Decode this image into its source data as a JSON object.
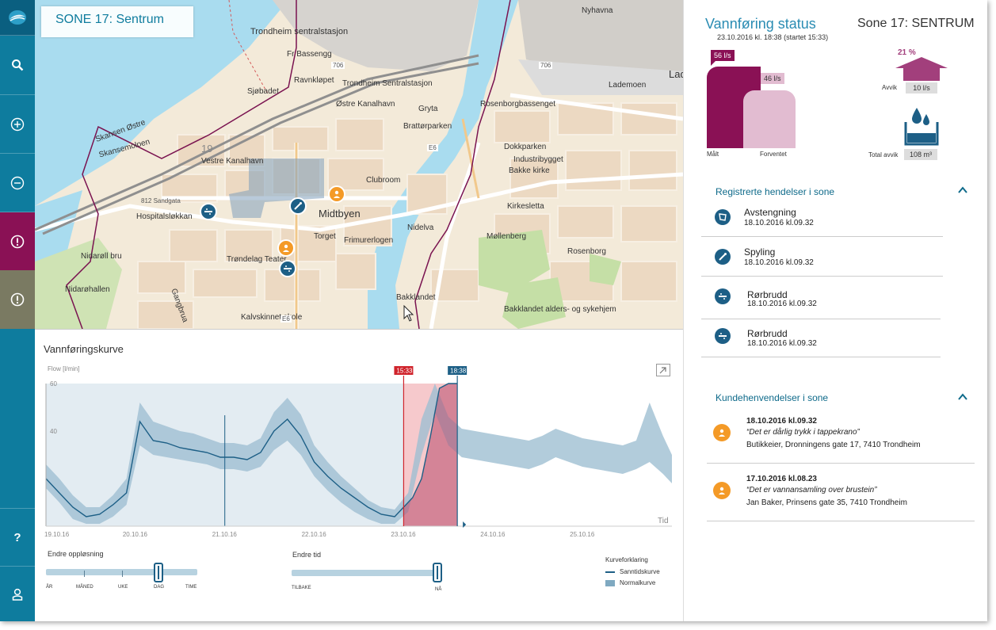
{
  "sidebar": {
    "items": [
      {
        "name": "logo",
        "icon": "logo-icon"
      },
      {
        "name": "search",
        "icon": "search-icon"
      },
      {
        "name": "zoom-in",
        "icon": "zoom-in-icon"
      },
      {
        "name": "zoom-out",
        "icon": "zoom-out-icon"
      },
      {
        "name": "alerts",
        "icon": "alert-icon"
      },
      {
        "name": "alerts-2",
        "icon": "alert-icon"
      }
    ],
    "help_label": "?",
    "user_icon": "user-icon",
    "colors": {
      "primary": "#0e7c9e",
      "alert_active": "#8a1155",
      "alert_inactive": "#7a7a62"
    }
  },
  "map": {
    "zone_title": "SONE 17: Sentrum",
    "labels": {
      "trondheim_sentralstasjon": "Trondheim sentralstasjon",
      "nyhavna": "Nyhavna",
      "fr_bassengg": "Fr Bassengg",
      "ravnkloløpet": "Ravnkløpet",
      "trondheim_sentralstasjon_2": "Trondheim Sentralstasjon",
      "sjobadet": "Sjøbadet",
      "ostre_kanalhavn": "Østre Kanalhavn",
      "gryta": "Gryta",
      "rosenborgbassenget": "Rosenborgbassenget",
      "skansen_ostre": "Skansen Østre",
      "skansemoloen": "Skansemoloen",
      "brattorparken": "Brattørparken",
      "dokkparken": "Dokkparken",
      "industribygget": "Industribygget",
      "vestre_kanalhavn": "Vestre Kanalhavn",
      "clubroom": "Clubroom",
      "bakke_kirke": "Bakke kirke",
      "midtbyen": "Midtbyen",
      "hospitalslokkan": "Hospitalsløkkan",
      "kirkesletta": "Kirkesletta",
      "torget": "Torget",
      "frimurerlogen": "Frimurerlogen",
      "nidelva": "Nidelva",
      "mollenberg": "Møllenberg",
      "nidarvoll_bru": "Nidarøll bru",
      "trondelag_teater": "Trøndelag Teater",
      "rosenborg": "Rosenborg",
      "nidarohallen": "Nidarøhallen",
      "gangbrua": "Gangbrua",
      "bakklandet": "Bakklandet",
      "bakklandet_sykehjem": "Bakklandet alders- og sykehjem",
      "kalvskinnet_skole": "Kalvskinnet skole",
      "lademoen": "Lademoen",
      "sentralsjon": "Sentralstasjon",
      "road_e6": "E6",
      "road_706": "706",
      "road_812": "812 Sandgata",
      "lad": "Lad",
      "zone_number": "19"
    }
  },
  "chart_panel": {
    "title": "Vannføringskurve",
    "expand_icon": "expand-icon",
    "time_axis_end": "Tid",
    "controls": {
      "resolution_label": "Endre oppløsning",
      "resolution_ticks": [
        "ÅR",
        "MÅNED",
        "UKE",
        "DAG",
        "TIME"
      ],
      "resolution_selected": "DAG",
      "time_label": "Endre tid",
      "time_ticks": [
        "TILBAKE",
        "NÅ"
      ],
      "time_selected": "NÅ"
    },
    "legend": {
      "title": "Kurveforklaring",
      "items": [
        {
          "label": "Sanntidskurve",
          "color": "#1d5f86"
        },
        {
          "label": "Normalkurve",
          "color": "#7fa9c1"
        }
      ]
    }
  },
  "chart_data": {
    "type": "area",
    "ylabel": "Flow [l/min]",
    "xlabel": "Tid",
    "ylim": [
      0,
      60
    ],
    "yticks": [
      40,
      60
    ],
    "x_ticks": [
      "19.10.16",
      "20.10.16",
      "21.10.16",
      "22.10.16",
      "23.10.16",
      "24.10.16",
      "25.10.16"
    ],
    "x_range_days": [
      "19.10.16",
      "26.10.16"
    ],
    "markers": [
      {
        "label": "15:33",
        "color": "#d0242c",
        "day": 4.0
      },
      {
        "label": "18:38",
        "color": "#1d5f86",
        "day": 4.6
      }
    ],
    "series": [
      {
        "name": "Sanntidskurve",
        "x_days": [
          0,
          0.15,
          0.3,
          0.45,
          0.6,
          0.75,
          0.9,
          1.05,
          1.2,
          1.35,
          1.5,
          1.65,
          1.8,
          1.95,
          2.1,
          2.25,
          2.4,
          2.55,
          2.7,
          2.85,
          3.0,
          3.15,
          3.3,
          3.45,
          3.6,
          3.75,
          3.9,
          4.0
        ],
        "values": [
          20,
          14,
          8,
          4,
          5,
          9,
          14,
          44,
          36,
          35,
          33,
          32,
          31,
          29,
          29,
          28,
          31,
          40,
          45,
          38,
          27,
          21,
          16,
          12,
          8,
          5,
          4,
          8
        ]
      },
      {
        "name": "Normalkurve",
        "x_days": [
          0,
          0.15,
          0.3,
          0.45,
          0.6,
          0.75,
          0.9,
          1.05,
          1.2,
          1.35,
          1.5,
          1.65,
          1.8,
          1.95,
          2.1,
          2.25,
          2.4,
          2.55,
          2.7,
          2.85,
          3.0,
          3.15,
          3.3,
          3.45,
          3.6,
          3.75,
          3.9,
          4.05,
          4.2,
          4.35,
          4.5,
          4.65,
          4.8,
          4.95,
          5.1,
          5.25,
          5.4,
          5.55,
          5.7,
          5.85,
          6.0,
          6.15,
          6.3,
          6.45,
          6.6,
          6.75,
          6.9,
          7.0
        ],
        "lower": [
          16,
          10,
          3,
          1,
          1,
          4,
          9,
          34,
          30,
          29,
          28,
          27,
          26,
          24,
          24,
          23,
          25,
          32,
          36,
          30,
          21,
          15,
          10,
          6,
          3,
          1,
          1,
          6,
          30,
          48,
          34,
          29,
          28,
          27,
          26,
          25,
          24,
          26,
          29,
          27,
          25,
          24,
          23,
          22,
          24,
          27,
          22,
          18
        ],
        "upper": [
          26,
          20,
          13,
          8,
          8,
          13,
          20,
          52,
          44,
          42,
          40,
          39,
          37,
          35,
          35,
          34,
          37,
          48,
          54,
          47,
          34,
          27,
          21,
          16,
          11,
          8,
          7,
          14,
          45,
          60,
          46,
          41,
          40,
          39,
          38,
          37,
          36,
          38,
          41,
          39,
          37,
          36,
          35,
          34,
          36,
          52,
          38,
          30
        ]
      },
      {
        "name": "Målt (15:33–18:38)",
        "x_days": [
          4.0,
          4.1,
          4.2,
          4.3,
          4.4,
          4.5,
          4.6
        ],
        "values": [
          8,
          12,
          20,
          38,
          58,
          60,
          60
        ]
      }
    ]
  },
  "status": {
    "title": "Vannføring status",
    "zone": "Sone 17: SENTRUM",
    "timestamp": "23.10.2016 kl. 18:38 (startet 15:33)",
    "measured": {
      "value": "56 l/s",
      "label": "Målt",
      "color": "#8a1155"
    },
    "expected": {
      "value": "46 l/s",
      "label": "Forventet",
      "color": "#e2bcd1"
    },
    "deviation": {
      "percent": "21 %",
      "label": "Avvik",
      "value": "10 l/s",
      "color": "#a23f7c"
    },
    "total_deviation": {
      "label": "Total avvik",
      "value": "108 m³",
      "color": "#1d5f86"
    }
  },
  "events": {
    "title": "Registrerte hendelser i sone",
    "items": [
      {
        "name": "Avstengning",
        "date": "18.10.2016 kl.09.32",
        "icon": "valve-icon"
      },
      {
        "name": "Spyling",
        "date": "18.10.2016 kl.09.32",
        "icon": "flush-icon"
      },
      {
        "name": "Rørbrudd",
        "date": "18.10.2016 kl.09.32",
        "icon": "pipe-burst-icon"
      },
      {
        "name": "Rørbrudd",
        "date": "18.10.2016 kl.09.32",
        "icon": "pipe-burst-icon"
      }
    ]
  },
  "customer": {
    "title": "Kundehenvendelser i sone",
    "items": [
      {
        "date": "18.10.2016 kl.09.32",
        "quote": "“Det er dårlig trykk i tappekrano”",
        "address": "Butikkeier, Dronningens gate 17, 7410 Trondheim"
      },
      {
        "date": "17.10.2016 kl.08.23",
        "quote": "“Det er vannansamling over brustein”",
        "address": "Jan Baker, Prinsens gate 35, 7410 Trondheim"
      }
    ]
  }
}
